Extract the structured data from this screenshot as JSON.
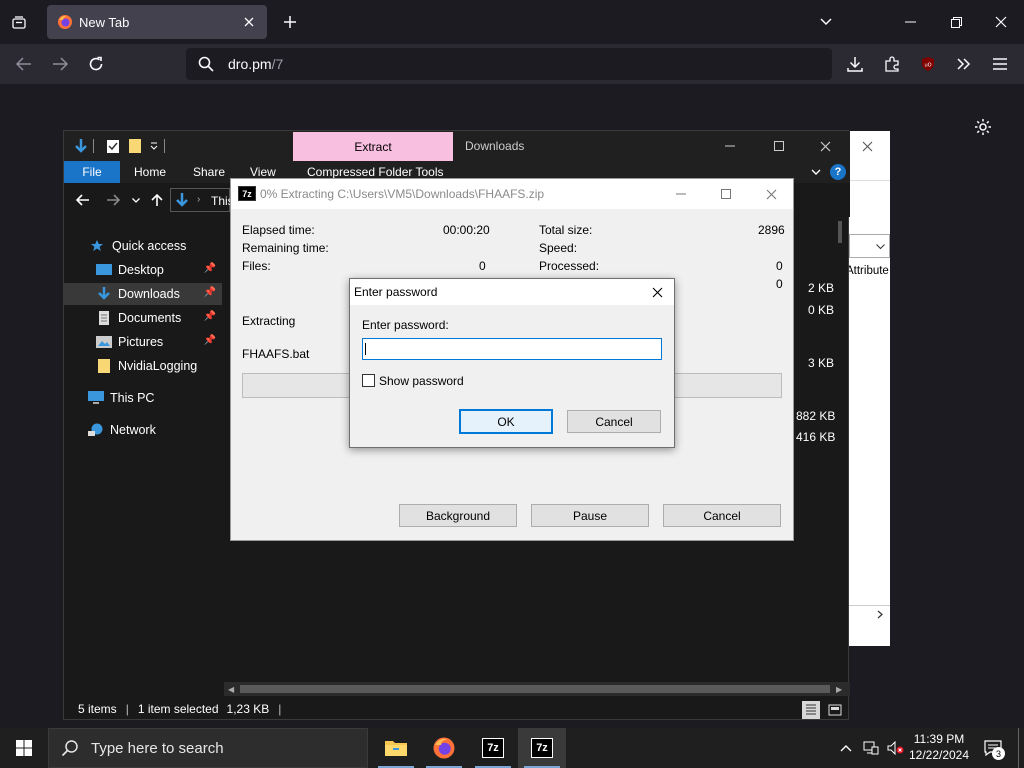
{
  "browser": {
    "tab_title": "New Tab",
    "url_host": "dro.pm",
    "url_path": "/7"
  },
  "explorer": {
    "extract_tab": "Extract",
    "title_downloads": "Downloads",
    "ribbon": [
      "File",
      "Home",
      "Share",
      "View",
      "Compressed Folder Tools"
    ],
    "address_this": "This",
    "nav": {
      "quick_access": "Quick access",
      "desktop": "Desktop",
      "downloads": "Downloads",
      "documents": "Documents",
      "pictures": "Pictures",
      "nvidia": "NvidiaLogging",
      "this_pc": "This PC",
      "network": "Network"
    },
    "sizes": [
      "2 KB",
      "0 KB",
      "3 KB",
      "882 KB",
      "416 KB"
    ],
    "attribute_header": "Attribute",
    "status": {
      "items": "5 items",
      "selected": "1 item selected",
      "size": "1,23 KB"
    }
  },
  "extract_dialog": {
    "icon_label": "7z",
    "title": "0% Extracting C:\\Users\\VM5\\Downloads\\FHAAFS.zip",
    "elapsed_label": "Elapsed time:",
    "elapsed_value": "00:00:20",
    "remaining_label": "Remaining time:",
    "files_label": "Files:",
    "files_value": "0",
    "total_size_label": "Total size:",
    "total_size_value": "2896",
    "speed_label": "Speed:",
    "processed_label": "Processed:",
    "processed_value": "0",
    "row4_value": "0",
    "extracting_label": "Extracting",
    "current_file": "FHAAFS.bat",
    "progress": 0,
    "background_button": "Background",
    "pause_button": "Pause",
    "cancel_button": "Cancel"
  },
  "password_dialog": {
    "title": "Enter password",
    "prompt": "Enter password:",
    "value": "",
    "show_password_label": "Show password",
    "show_password_checked": false,
    "ok_button": "OK",
    "cancel_button": "Cancel"
  },
  "taskbar": {
    "search_placeholder": "Type here to search",
    "time": "11:39 PM",
    "date": "12/22/2024",
    "app_7z_label": "7z",
    "notification_count": "3"
  },
  "colors": {
    "accent": "#1a74c8",
    "extract_tab": "#f9bfe0",
    "ok_border": "#0078d7"
  }
}
